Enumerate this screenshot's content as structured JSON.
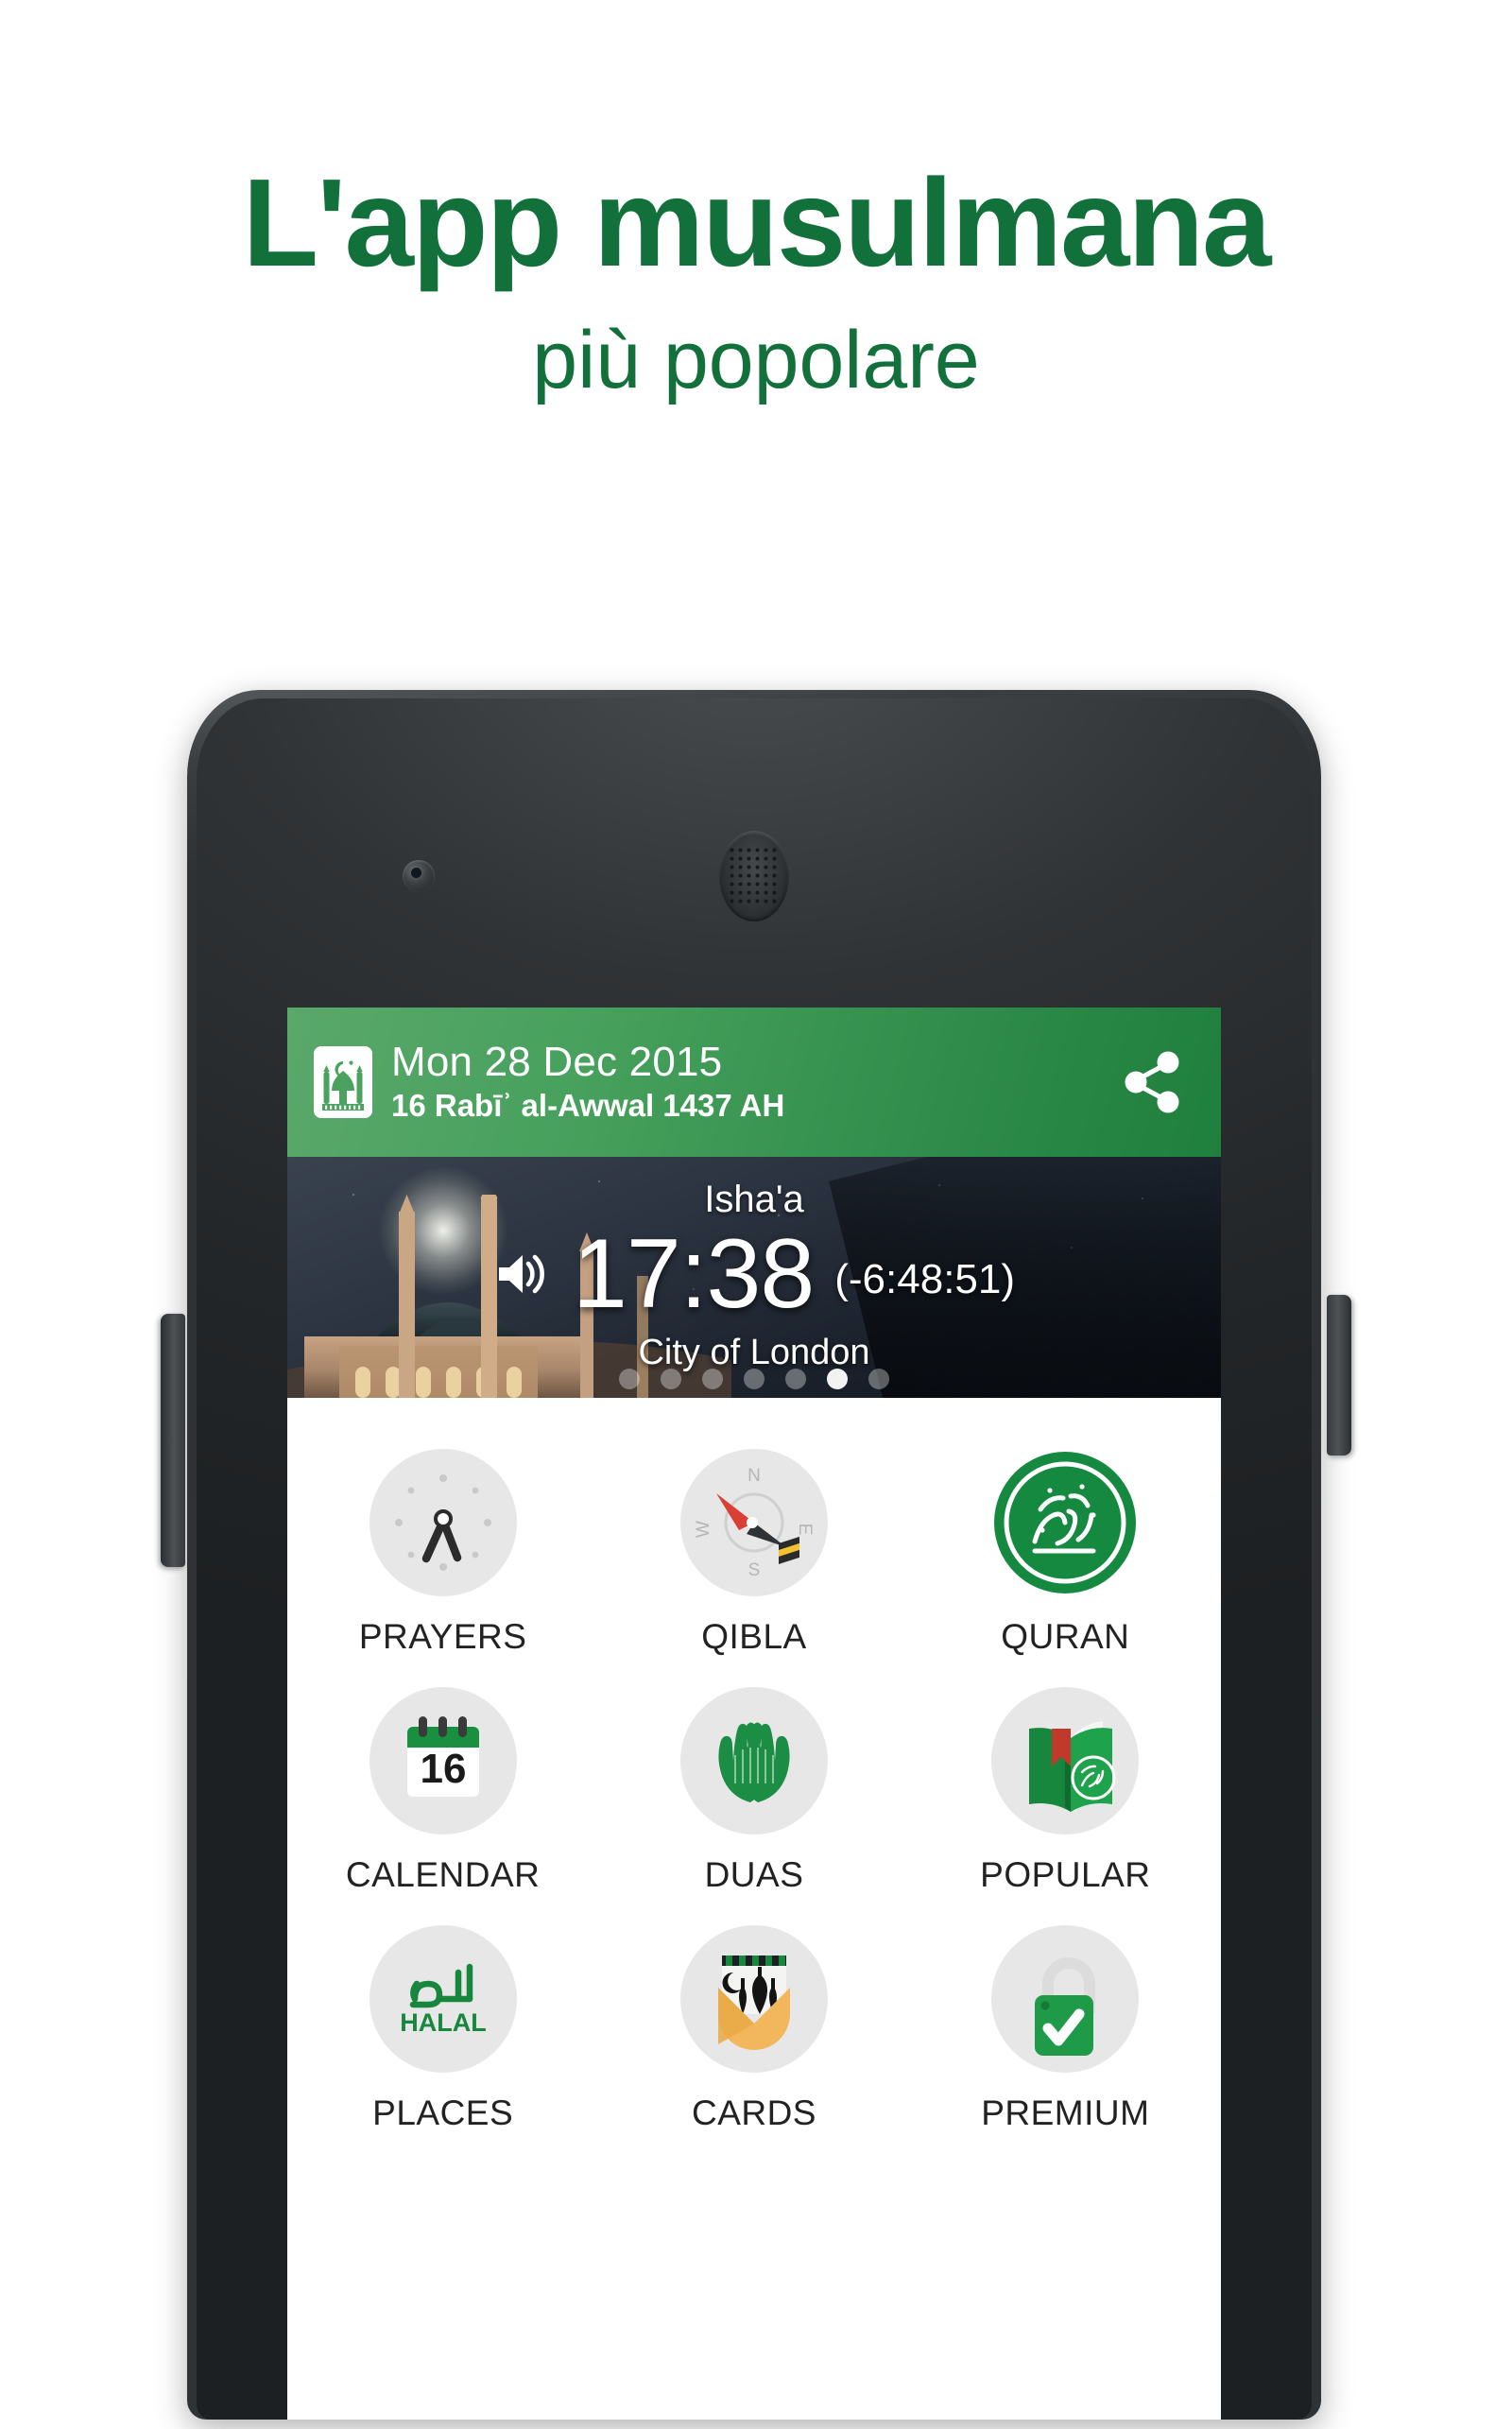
{
  "promo": {
    "title": "L'app musulmana",
    "subtitle": "più popolare",
    "title_color": "#12703a"
  },
  "phone": {
    "hardware": {
      "front_camera": "front-camera",
      "earpiece": "earpiece-speaker",
      "power_button": "power-button",
      "volume_button": "volume-rocker"
    }
  },
  "app": {
    "appbar": {
      "logo_icon": "mosque-icon",
      "gregorian_date": "Mon 28 Dec 2015",
      "hijri_date": "16 Rabīʾ al-Awwal 1437 AH",
      "share_icon": "share-icon",
      "background_color": "#2e8b49"
    },
    "hero": {
      "prayer_name": "Isha'a",
      "prayer_time": "17:38",
      "countdown": "(-6:48:51)",
      "location": "City of London",
      "volume_icon": "volume-icon",
      "page_dots_total": 7,
      "page_dots_active_index": 5
    },
    "grid": {
      "tiles": [
        {
          "label": "PRAYERS",
          "icon": "clock-icon"
        },
        {
          "label": "QIBLA",
          "icon": "compass-icon"
        },
        {
          "label": "QURAN",
          "icon": "quran-seal-icon"
        },
        {
          "label": "CALENDAR",
          "icon": "calendar-icon",
          "badge": "16"
        },
        {
          "label": "DUAS",
          "icon": "praying-hands-icon"
        },
        {
          "label": "POPULAR",
          "icon": "open-book-icon"
        },
        {
          "label": "PLACES",
          "icon": "halal-icon",
          "badge": "HALAL"
        },
        {
          "label": "CARDS",
          "icon": "greeting-card-icon"
        },
        {
          "label": "PREMIUM",
          "icon": "padlock-check-icon"
        }
      ]
    }
  }
}
